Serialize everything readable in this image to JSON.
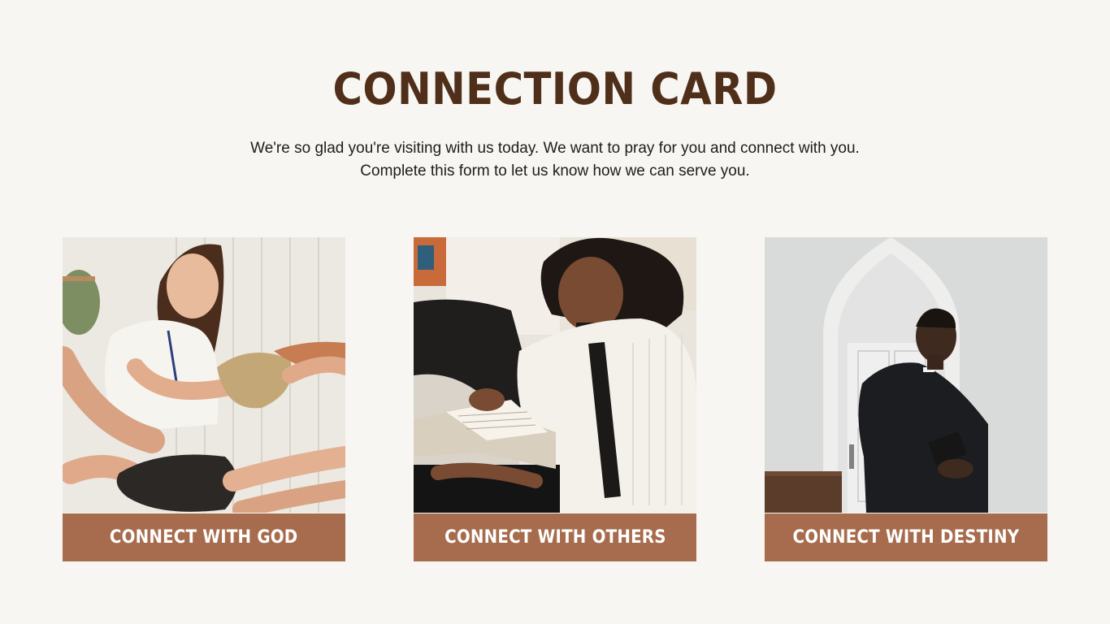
{
  "header": {
    "title": "CONNECTION CARD",
    "intro_line_1": "We're so glad you're visiting with us today. We want to pray for you and connect with you.",
    "intro_line_2": "Complete this form to let us know how we can serve you."
  },
  "cards": [
    {
      "label": "CONNECT WITH GOD",
      "image_icon": "volunteer-photo"
    },
    {
      "label": "CONNECT WITH OTHERS",
      "image_icon": "reading-photo"
    },
    {
      "label": "CONNECT WITH DESTINY",
      "image_icon": "pastor-photo"
    }
  ],
  "colors": {
    "background": "#f8f6f2",
    "title": "#4f2f19",
    "label_band": "#a66c4d",
    "label_text": "#ffffff"
  }
}
